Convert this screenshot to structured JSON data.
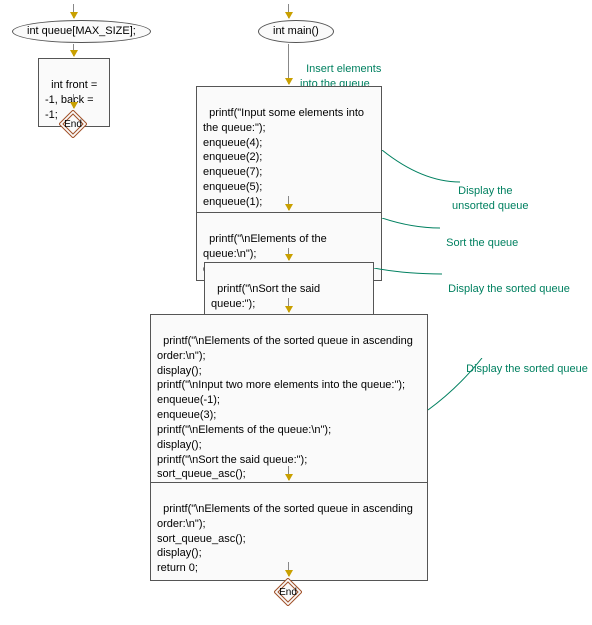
{
  "left": {
    "terminal": "int queue[MAX_SIZE];",
    "box1": "int front =\n-1, back = -1;",
    "end": "End"
  },
  "right": {
    "terminal": "int main()",
    "box1": "printf(\"Input some elements into\nthe queue:\");\nenqueue(4);\nenqueue(2);\nenqueue(7);\nenqueue(5);\nenqueue(1);",
    "box2": "printf(\"\\nElements of the queue:\\n\");\ndisplay();",
    "box3": "printf(\"\\nSort the said queue:\");\nsort_queue_asc();",
    "box4": "printf(\"\\nElements of the sorted queue in ascending\norder:\\n\");\ndisplay();\nprintf(\"\\nInput two more elements into the queue:\");\nenqueue(-1);\nenqueue(3);\nprintf(\"\\nElements of the queue:\\n\");\ndisplay();\nprintf(\"\\nSort the said queue:\");\nsort_queue_asc();",
    "box5": "printf(\"\\nElements of the sorted queue in ascending\norder:\\n\");\nsort_queue_asc();\ndisplay();\nreturn 0;",
    "end": "End"
  },
  "annotations": {
    "a1": "Insert elements\ninto the queue",
    "a2": "Display the\nunsorted queue",
    "a3": "Sort the queue",
    "a4": "Display the sorted queue",
    "a5": "Display the sorted queue"
  }
}
